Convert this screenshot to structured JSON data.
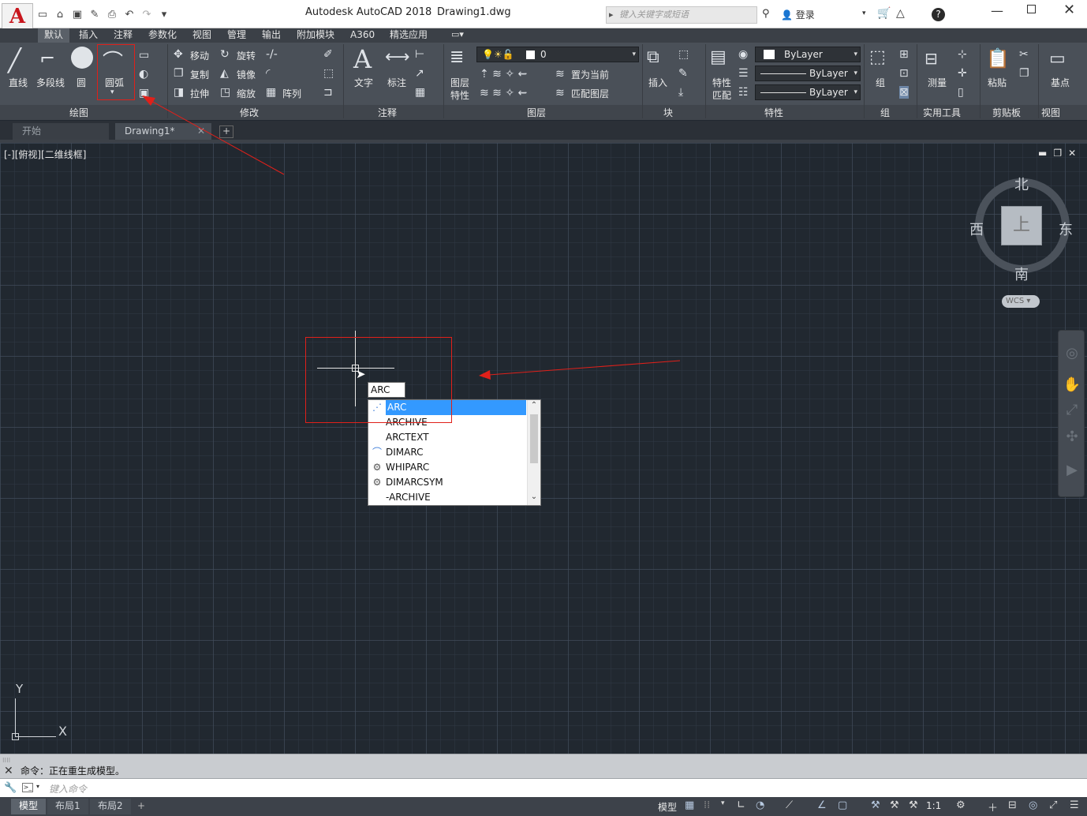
{
  "titlebar": {
    "logo": "A",
    "app_title": "Autodesk AutoCAD 2018",
    "file_name": "Drawing1.dwg",
    "search_placeholder": "键入关键字或短语",
    "login": "登录"
  },
  "ribbon_tabs": [
    "默认",
    "插入",
    "注释",
    "参数化",
    "视图",
    "管理",
    "输出",
    "附加模块",
    "A360",
    "精选应用"
  ],
  "ribbon": {
    "draw": {
      "line": "直线",
      "polyline": "多段线",
      "circle": "圆",
      "arc": "圆弧",
      "title": "绘图"
    },
    "modify": {
      "move": "移动",
      "rotate": "旋转",
      "copy": "复制",
      "mirror": "镜像",
      "stretch": "拉伸",
      "scale": "缩放",
      "array": "阵列",
      "title": "修改"
    },
    "annotation": {
      "text": "文字",
      "dimension": "标注",
      "title": "注释"
    },
    "layers": {
      "layer_props_1": "图层",
      "layer_props_2": "特性",
      "layer_value": "0",
      "set_current": "置为当前",
      "match_layer": "匹配图层",
      "title": "图层"
    },
    "block": {
      "insert": "插入",
      "title": "块"
    },
    "properties": {
      "match_1": "特性",
      "match_2": "匹配",
      "color": "ByLayer",
      "linetype": "ByLayer",
      "lineweight": "ByLayer",
      "title": "特性"
    },
    "groups": {
      "group": "组",
      "title": "组"
    },
    "utilities": {
      "measure": "测量",
      "title": "实用工具"
    },
    "clipboard": {
      "paste": "粘贴",
      "title": "剪贴板"
    },
    "view": {
      "base": "基点",
      "title": "视图"
    }
  },
  "file_tabs": {
    "start": "开始",
    "drawing": "Drawing1*"
  },
  "viewport": {
    "label": "[-][俯视][二维线框]",
    "viewcube": {
      "north": "北",
      "south": "南",
      "east": "东",
      "west": "西",
      "face": "上",
      "wcs": "WCS"
    },
    "ucs": {
      "x": "X",
      "y": "Y"
    }
  },
  "command_input": {
    "typed": "ARC",
    "suggestions": [
      "ARC",
      "ARCHIVE",
      "ARCTEXT",
      "DIMARC",
      "WHIPARC",
      "DIMARCSYM",
      "-ARCHIVE"
    ],
    "selected_index": 0
  },
  "command_line": {
    "history": "命令：正在重生成模型。",
    "placeholder": "键入命令"
  },
  "status_bar": {
    "layout_tabs": [
      "模型",
      "布局1",
      "布局2"
    ],
    "model_label": "模型",
    "scale": "1:1"
  },
  "colors": {
    "canvas_bg": "#212830",
    "ribbon_bg": "#4a5058",
    "annotation_red": "#e0201a",
    "selection_blue": "#3399ff"
  }
}
